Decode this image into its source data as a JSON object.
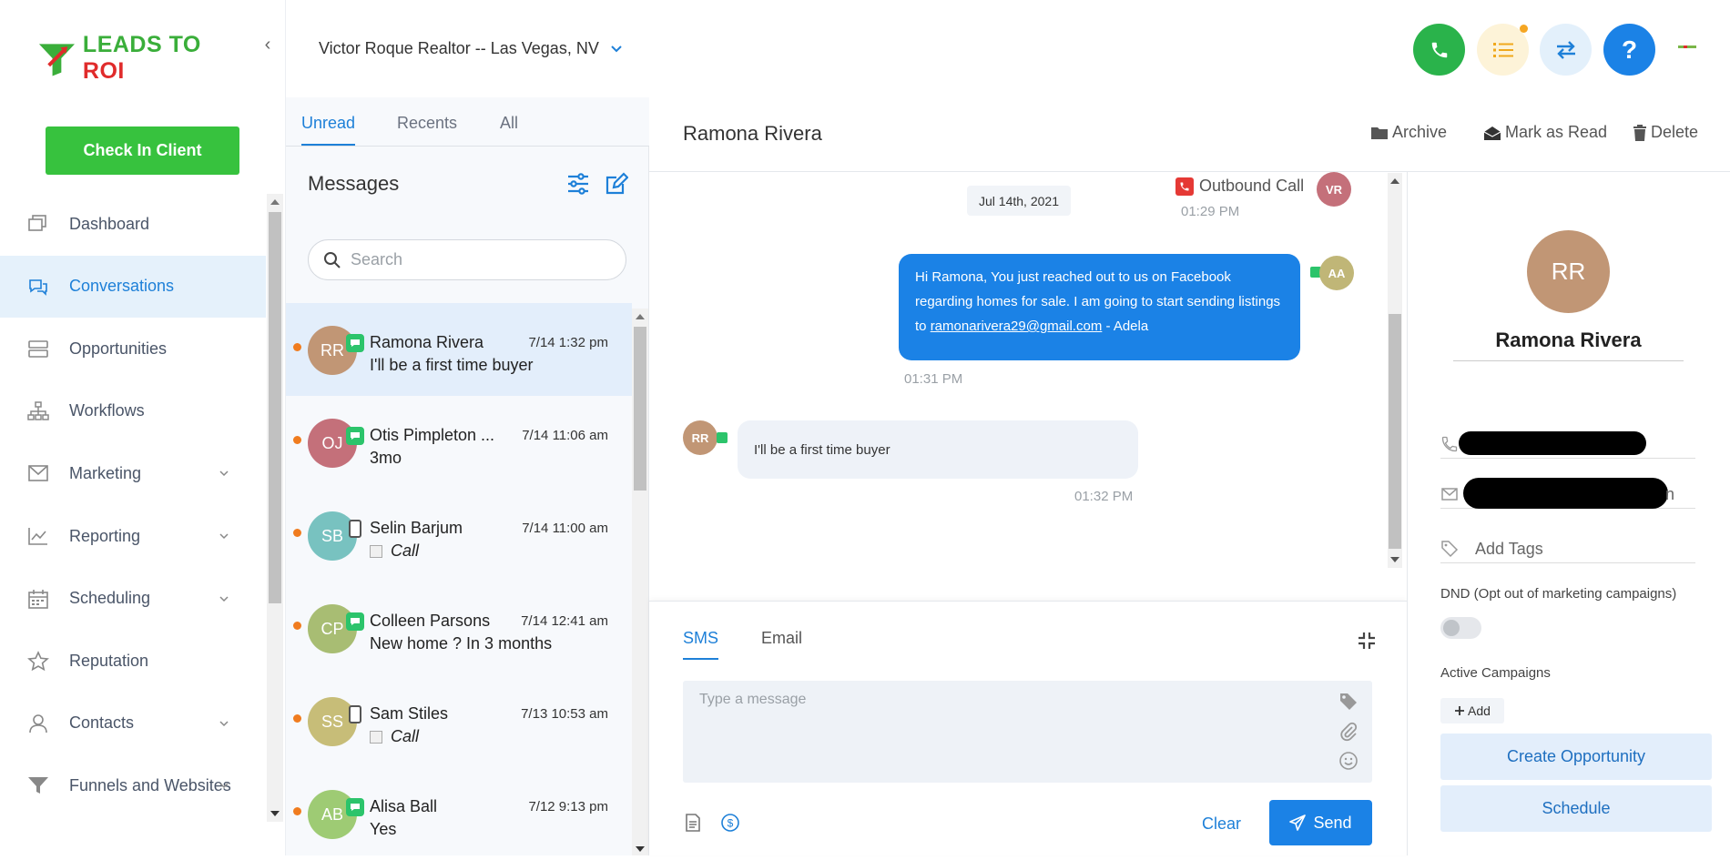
{
  "app": {
    "logo_text_green": "LEADS TO ",
    "logo_text_red": "ROI",
    "brand_color": "#37c23e",
    "accent_color": "#1e80d8"
  },
  "sidebar": {
    "check_in_label": "Check In Client",
    "items": [
      {
        "label": "Dashboard",
        "icon": "dashboard-icon",
        "active": false,
        "has_chevron": false
      },
      {
        "label": "Conversations",
        "icon": "chat-icon",
        "active": true,
        "has_chevron": false
      },
      {
        "label": "Opportunities",
        "icon": "opportunities-icon",
        "active": false,
        "has_chevron": false
      },
      {
        "label": "Workflows",
        "icon": "workflow-icon",
        "active": false,
        "has_chevron": false
      },
      {
        "label": "Marketing",
        "icon": "mail-icon",
        "active": false,
        "has_chevron": true
      },
      {
        "label": "Reporting",
        "icon": "chart-icon",
        "active": false,
        "has_chevron": true
      },
      {
        "label": "Scheduling",
        "icon": "calendar-icon",
        "active": false,
        "has_chevron": true
      },
      {
        "label": "Reputation",
        "icon": "star-icon",
        "active": false,
        "has_chevron": false
      },
      {
        "label": "Contacts",
        "icon": "user-icon",
        "active": false,
        "has_chevron": true
      },
      {
        "label": "Funnels and Websites",
        "icon": "funnel-icon",
        "active": false,
        "has_chevron": true
      }
    ]
  },
  "header": {
    "account_name": "Victor Roque Realtor -- Las Vegas, NV",
    "buttons": [
      "phone-icon",
      "task-list-icon",
      "swap-icon",
      "help-icon"
    ],
    "help_label": "?"
  },
  "messages": {
    "tabs": [
      "Unread",
      "Recents",
      "All"
    ],
    "active_tab": "Unread",
    "title": "Messages",
    "search_placeholder": "Search",
    "conversations": [
      {
        "initials": "RR",
        "name": "Ramona Rivera",
        "time": "7/14 1:32 pm",
        "preview": "I'll be a first time buyer",
        "channel": "sms",
        "color": "#c19675",
        "selected": true
      },
      {
        "initials": "OJ",
        "name": "Otis Pimpleton ...",
        "time": "7/14 11:06 am",
        "preview": "3mo",
        "channel": "sms",
        "color": "#c4707a",
        "selected": false
      },
      {
        "initials": "SB",
        "name": "Selin Barjum",
        "time": "7/14 11:00 am",
        "preview": "Call",
        "channel": "phone",
        "color": "#78c2c0",
        "selected": false
      },
      {
        "initials": "CP",
        "name": "Colleen Parsons",
        "time": "7/14 12:41 am",
        "preview": "New home ? In 3 months",
        "channel": "sms",
        "color": "#a8bd73",
        "selected": false
      },
      {
        "initials": "SS",
        "name": "Sam Stiles",
        "time": "7/13 10:53 am",
        "preview": "Call",
        "channel": "phone",
        "color": "#c7bd78",
        "selected": false
      },
      {
        "initials": "AB",
        "name": "Alisa Ball",
        "time": "7/12 9:13 pm",
        "preview": "Yes",
        "channel": "sms",
        "color": "#9ecb74",
        "selected": false
      }
    ]
  },
  "chat": {
    "contact_name": "Ramona Rivera",
    "actions": {
      "archive": "Archive",
      "mark_read": "Mark as Read",
      "delete": "Delete"
    },
    "date_chip": "Jul 14th, 2021",
    "outbound_call": {
      "label": "Outbound Call",
      "time": "01:29 PM",
      "avatar": "VR",
      "avatar_color": "#c4707a"
    },
    "outgoing": {
      "text_before": "Hi Ramona, You just reached out to us on Facebook regarding homes for sale. I am going to start sending listings to ",
      "email": "ramonarivera29@gmail.com",
      "text_after": " - Adela",
      "time": "01:31 PM",
      "avatar": "AA",
      "avatar_color": "#c0b677"
    },
    "incoming": {
      "text": "I'll be a first time buyer",
      "time": "01:32 PM",
      "avatar": "RR",
      "avatar_color": "#c19675"
    },
    "composer": {
      "tabs": [
        "SMS",
        "Email"
      ],
      "active_tab": "SMS",
      "placeholder": "Type a message",
      "clear_label": "Clear",
      "send_label": "Send"
    }
  },
  "contact_panel": {
    "initials": "RR",
    "name": "Ramona Rivera",
    "tags_placeholder": "Add Tags",
    "email_suffix": "n",
    "dnd_label": "DND (Opt out of marketing campaigns)",
    "dnd_on": false,
    "active_campaigns_label": "Active Campaigns",
    "add_label": "Add",
    "create_opportunity_label": "Create Opportunity",
    "schedule_label": "Schedule"
  }
}
